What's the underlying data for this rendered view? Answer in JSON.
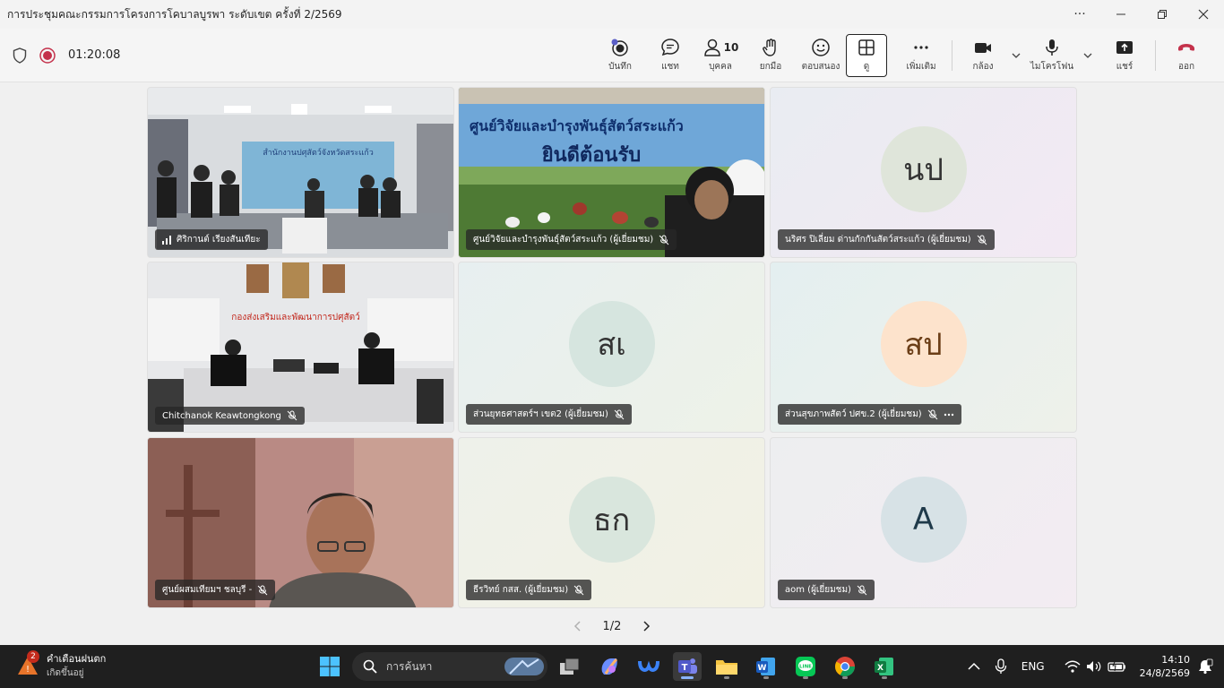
{
  "window": {
    "title": "การประชุมคณะกรรมการโครงการโคบาลบูรพา ระดับเขต ครั้งที่ 2/2569",
    "more": "···"
  },
  "toolbar": {
    "timer": "01:20:08",
    "items": {
      "record": "บันทึก",
      "chat": "แชท",
      "people": "บุคคล",
      "people_count": "10",
      "raise": "ยกมือ",
      "react": "ตอบสนอง",
      "view": "ดู",
      "more": "เพิ่มเติม",
      "camera": "กล้อง",
      "mic": "ไมโครโฟน",
      "share": "แชร์",
      "leave": "ออก"
    }
  },
  "tiles": [
    {
      "name": "ศิริกานต์ เรียงสันเทียะ",
      "type": "video",
      "scene": "conference-room"
    },
    {
      "name": "ศูนย์วิจัยและบำรุงพันธุ์สัตว์สระแก้ว (ผู้เยี่ยมชม)",
      "type": "video",
      "scene": "banner"
    },
    {
      "name": "นริศร ปิเลี่ยม ด่านกักกันสัตว์สระแก้ว (ผู้เยี่ยมชม)",
      "type": "avatar",
      "initials": "นป",
      "avatar_color": "#dfe5da"
    },
    {
      "name": "Chitchanok Keawtongkong",
      "type": "video",
      "scene": "meeting-room"
    },
    {
      "name": "ส่วนยุทธศาสตร์ฯ เขต2 (ผู้เยี่ยมชม)",
      "type": "avatar",
      "initials": "สเ",
      "avatar_color": "#d6e5df"
    },
    {
      "name": "ส่วนสุขภาพสัตว์ ปศข.2 (ผู้เยี่ยมชม)",
      "type": "avatar",
      "initials": "สป",
      "avatar_color": "#fde3cc"
    },
    {
      "name": "ศูนย์ผสมเทียมฯ ชลบุรี -",
      "type": "video",
      "scene": "person"
    },
    {
      "name": "ธีรวิทย์ กสส. (ผู้เยี่ยมชม)",
      "type": "avatar",
      "initials": "ธก",
      "avatar_color": "#d9e6dd"
    },
    {
      "name": "aom (ผู้เยี่ยมชม)",
      "type": "avatar",
      "initials": "A",
      "avatar_color": "#d7e2e6"
    }
  ],
  "scene_text": {
    "banner_top": "ศูนย์วิจัยและบำรุงพันธุ์สัตว์สระแก้ว",
    "banner_welcome": "ยินดีต้อนรับ",
    "room1_sign": "สำนักงานปศุสัตว์จังหวัดสระแก้ว",
    "room2_sign": "กองส่งเสริมและพัฒนาการปศุสัตว์"
  },
  "pager": {
    "label": "1/2"
  },
  "taskbar": {
    "weather_badge": "2",
    "weather_title": "คำเตือนฝนตก",
    "weather_sub": "เกิดขึ้นอยู่",
    "search_placeholder": "การค้นหา",
    "lang": "ENG",
    "time": "14:10",
    "date": "24/8/2569"
  },
  "colors": {
    "leave": "#c4314b",
    "accent": "#5b5fc7",
    "taskbar": "#1f1f1f"
  }
}
